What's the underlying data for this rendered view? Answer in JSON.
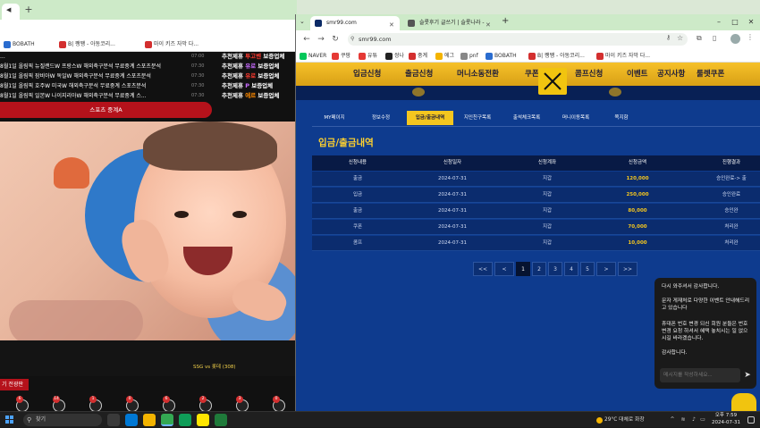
{
  "left_window": {
    "bookmarks": [
      {
        "label": "BOBATH",
        "color": "#2a6ccf"
      },
      {
        "label": "B| 쨍쨍 - 아동코리...",
        "color": "#d32f2f"
      },
      {
        "label": "마이 키즈 자막 다...",
        "color": "#d32f2f"
      }
    ],
    "news": [
      {
        "title": "...",
        "time": "07:00",
        "pick_prefix": "추천제휴 ",
        "pick_highlight": "투고벤",
        "pick_suffix": " 보증업체",
        "hl": "hl"
      },
      {
        "title": "8월1일 올림픽 뉴질랜드W 프랑스W 해외축구분석 무료중계 스포츠분석",
        "time": "07:30",
        "pick_prefix": "추천제휴 ",
        "pick_highlight": "유로",
        "pick_suffix": " 보증업체",
        "hl": "hl2"
      },
      {
        "title": "8월1일 올림픽 잠비아W 독일W 해외축구분석 무료중계 스포츠분석",
        "time": "07:30",
        "pick_prefix": "추천제휴 ",
        "pick_highlight": "유로",
        "pick_suffix": " 보증업체",
        "hl": "hl"
      },
      {
        "title": "8월1일 올림픽 호주W 미국W 해외축구분석 무료중계 스포츠분석",
        "time": "07:30",
        "pick_prefix": "추천제휴 ",
        "pick_highlight": "P",
        "pick_suffix": " 보증업체",
        "hl": "hl2"
      },
      {
        "title": "8월1일 올림픽 일본W 나이지리아W 해외축구분석 무료중계 스...",
        "time": "07:30",
        "pick_prefix": "추천제휴 ",
        "pick_highlight": "에르",
        "pick_suffix": " 보증업체",
        "hl": "hl3"
      }
    ],
    "sports_button": "스포츠 중계A",
    "score_text": "SSG vs   롯데 (308)",
    "red_tag": "기 전광판",
    "sports_icons": [
      {
        "badge": "6"
      },
      {
        "badge": "14"
      },
      {
        "badge": "1"
      },
      {
        "badge": "0"
      },
      {
        "badge": "6"
      },
      {
        "badge": "2"
      },
      {
        "badge": "3"
      },
      {
        "badge": "0"
      }
    ]
  },
  "right_window": {
    "tabs": [
      {
        "label": "smr99.com",
        "active": true,
        "icon_color": "#0b2a66"
      },
      {
        "label": "슬롯후기 글쓰기 | 슬롯나라 -",
        "active": false,
        "icon_color": "#555"
      }
    ],
    "url": "smr99.com",
    "bookmarks": [
      {
        "label": "NAVER",
        "color": "#03c75a"
      },
      {
        "label": "쿠팡",
        "color": "#e53935"
      },
      {
        "label": "유튜",
        "color": "#e53935"
      },
      {
        "label": "쌍나",
        "color": "#222"
      },
      {
        "label": "중계",
        "color": "#d32f2f"
      },
      {
        "label": "에그",
        "color": "#f4b400"
      },
      {
        "label": "pnf",
        "color": "#888"
      },
      {
        "label": "BOBATH",
        "color": "#2a6ccf"
      },
      {
        "label": "B| 쨍쨍 - 아동코리...",
        "color": "#d32f2f"
      },
      {
        "label": "마이 키즈 자막 다...",
        "color": "#d32f2f"
      }
    ],
    "site_nav": [
      "입금신청",
      "출금신청",
      "머니소동전환",
      "쿠폰",
      "콤프신청",
      "이벤트",
      "공지사항",
      "룰렛쿠폰"
    ],
    "sub_tabs": [
      {
        "label": "MY페이지",
        "active": false
      },
      {
        "label": "정보수정",
        "active": false
      },
      {
        "label": "입금/출금내역",
        "active": true
      },
      {
        "label": "지인친구목록",
        "active": false
      },
      {
        "label": "출석체크목록",
        "active": false
      },
      {
        "label": "머니이동목록",
        "active": false
      },
      {
        "label": "쪽지함",
        "active": false
      }
    ],
    "section_title": "입금/출금내역",
    "table": {
      "headers": [
        "신청내용",
        "신청일자",
        "신청계좌",
        "신청금액",
        "진행결과"
      ],
      "rows": [
        [
          "출금",
          "2024-07-31",
          "지갑",
          "120,000",
          "승인완료-> 출"
        ],
        [
          "입금",
          "2024-07-31",
          "지갑",
          "250,000",
          "승인완료"
        ],
        [
          "출금",
          "2024-07-31",
          "지갑",
          "80,000",
          "승인완"
        ],
        [
          "쿠폰",
          "2024-07-31",
          "지갑",
          "70,000",
          "처리완"
        ],
        [
          "콤프",
          "2024-07-31",
          "지갑",
          "10,000",
          "처리완"
        ]
      ]
    },
    "pager": {
      "first": "<<",
      "prev": "<",
      "pages": [
        "1",
        "2",
        "3",
        "4",
        "5"
      ],
      "active_page": "1",
      "next": ">",
      "last": ">>"
    }
  },
  "chat": {
    "messages": [
      "다시 와주셔서 감사합니다.",
      "문자 게재처로 다양한 이벤트 안내해드리고 있습니다",
      "휴대폰 번호 변경 되신 회원 분들은 번호 변경 요청 하셔서 혜택 놓치시는 일 없으시길 바라겠습니다.",
      "감사합니다."
    ],
    "input_placeholder": "메시지를 작성하세요..."
  },
  "taskbar": {
    "search_placeholder": "찾기",
    "weather": "29°C  대체로 화창",
    "time": "오후 7:59",
    "date": "2024-07-31",
    "apps": [
      {
        "color": "#3a3a3a",
        "active": false
      },
      {
        "color": "#0078d4",
        "active": false
      },
      {
        "color": "#f4b400",
        "active": false
      },
      {
        "color": "#34a853",
        "active": true
      },
      {
        "color": "#0f9d58",
        "active": false
      },
      {
        "color": "#ffe600",
        "active": false
      },
      {
        "color": "#1f7a3a",
        "active": false
      }
    ]
  },
  "colors": {
    "site_bg": "#0b2a66",
    "accent_gold": "#f4c61f",
    "red": "#b5121b"
  }
}
